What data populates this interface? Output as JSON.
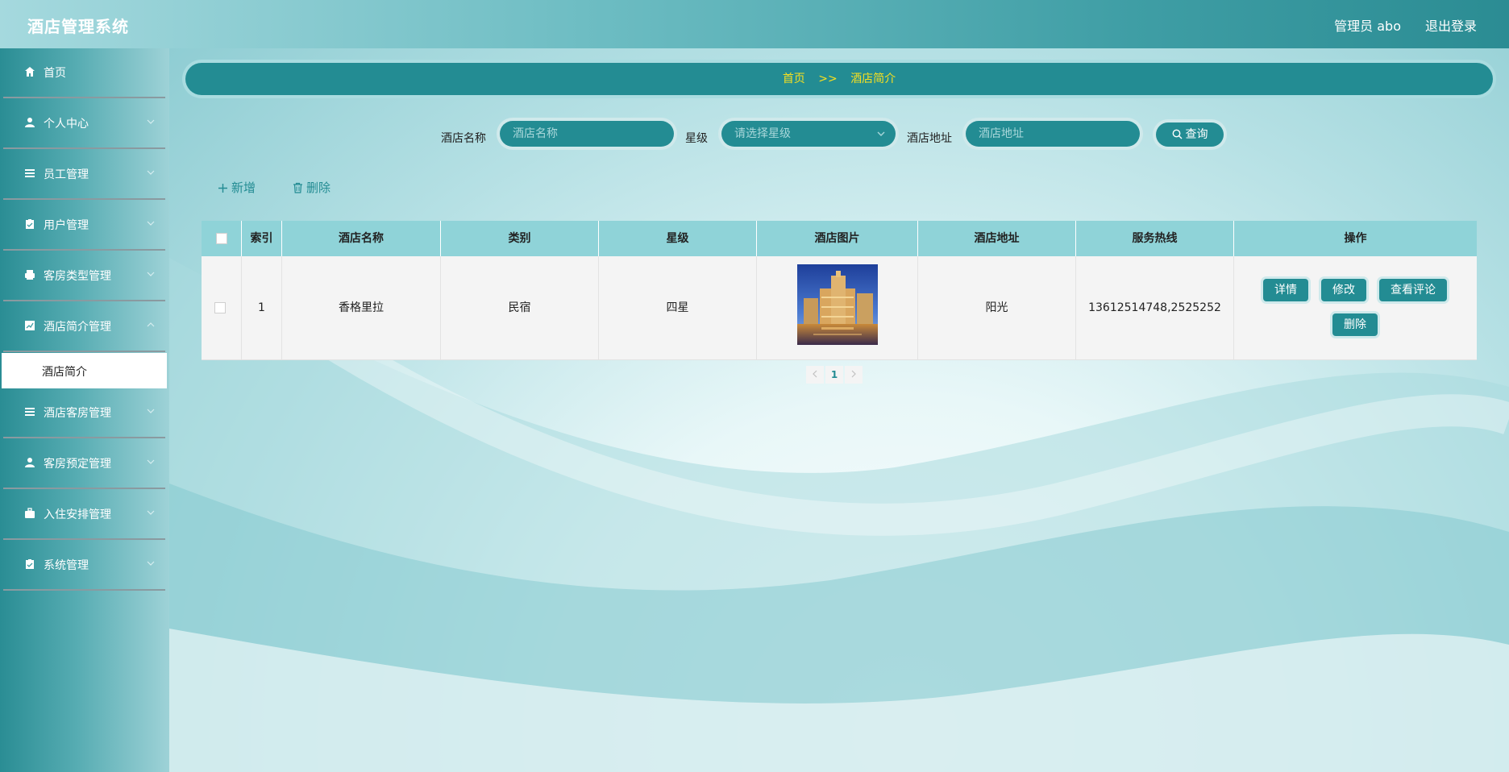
{
  "app": {
    "title": "酒店管理系统"
  },
  "topbar": {
    "user": "管理员 abo",
    "logout": "退出登录"
  },
  "sidebar": {
    "items": [
      {
        "label": "首页",
        "icon": "home-icon"
      },
      {
        "label": "个人中心",
        "icon": "user-icon"
      },
      {
        "label": "员工管理",
        "icon": "list-icon"
      },
      {
        "label": "用户管理",
        "icon": "clipboard-icon"
      },
      {
        "label": "客房类型管理",
        "icon": "printer-icon"
      },
      {
        "label": "酒店简介管理",
        "icon": "chart-icon"
      },
      {
        "label": "酒店客房管理",
        "icon": "list-icon"
      },
      {
        "label": "客房预定管理",
        "icon": "user-icon"
      },
      {
        "label": "入住安排管理",
        "icon": "briefcase-icon"
      },
      {
        "label": "系统管理",
        "icon": "clipboard-icon"
      }
    ],
    "active_sub": "酒店简介"
  },
  "breadcrumb": {
    "home": "首页",
    "sep": ">>",
    "current": "酒店简介"
  },
  "search": {
    "name_label": "酒店名称",
    "name_placeholder": "酒店名称",
    "star_label": "星级",
    "star_placeholder": "请选择星级",
    "address_label": "酒店地址",
    "address_placeholder": "酒店地址",
    "button": "查询"
  },
  "actions": {
    "add": "新增",
    "delete": "删除"
  },
  "table": {
    "headers": [
      "索引",
      "酒店名称",
      "类别",
      "星级",
      "酒店图片",
      "酒店地址",
      "服务热线",
      "操作"
    ],
    "rows": [
      {
        "index": "1",
        "name": "香格里拉",
        "category": "民宿",
        "star": "四星",
        "address": "阳光",
        "hotline": "13612514748,2525252",
        "ops": [
          "详情",
          "修改",
          "查看评论",
          "删除"
        ]
      }
    ]
  },
  "pagination": {
    "current": "1"
  },
  "colors": {
    "primary": "#238c93",
    "breadcrumb_text": "#f7e01f",
    "header": "#8fd3d8"
  }
}
